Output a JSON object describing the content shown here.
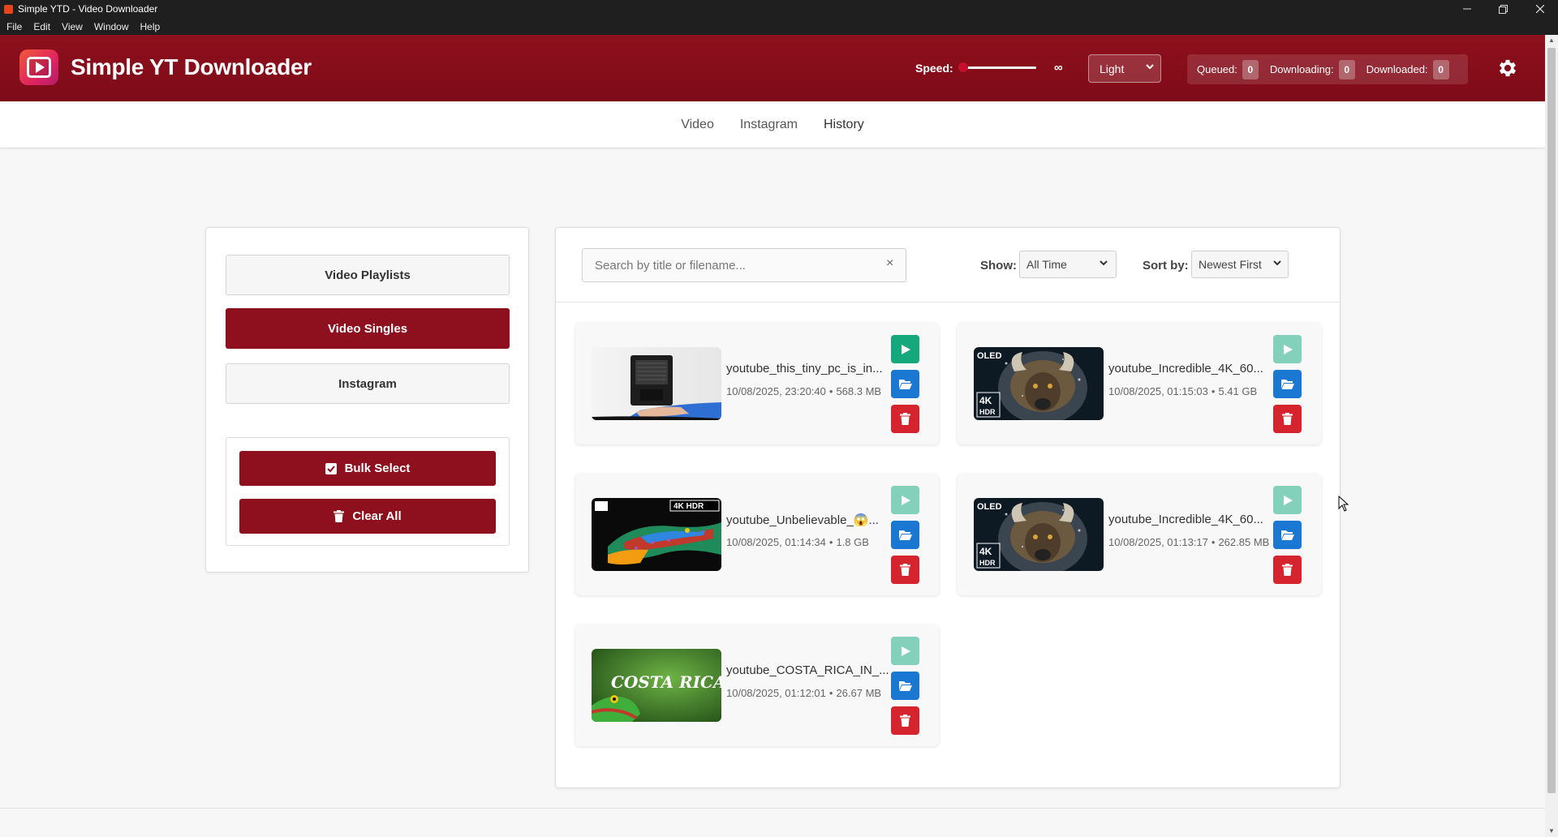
{
  "window": {
    "title": "Simple YTD - Video Downloader"
  },
  "menu": [
    "File",
    "Edit",
    "View",
    "Window",
    "Help"
  ],
  "header": {
    "brand": "Simple YT Downloader",
    "speed_label": "Speed:",
    "speed_value": "∞",
    "speed_level": 0,
    "theme": "Light",
    "counters": [
      {
        "label": "Queued:",
        "value": "0"
      },
      {
        "label": "Downloading:",
        "value": "0"
      },
      {
        "label": "Downloaded:",
        "value": "0"
      }
    ],
    "accent_color": "#8e0f1d"
  },
  "tabs": [
    "Video",
    "Instagram",
    "History"
  ],
  "active_tab": "History",
  "sidebar": {
    "items": [
      "Video Playlists",
      "Video Singles",
      "Instagram"
    ],
    "active": "Video Singles",
    "bulk_select": "Bulk Select",
    "clear_all": "Clear All"
  },
  "toolbar": {
    "search_placeholder": "Search by title or filename...",
    "search_clear": "×",
    "show_label": "Show:",
    "show_value": "All Time",
    "sort_label": "Sort by:",
    "sort_value": "Newest First"
  },
  "history": [
    {
      "title": "youtube_this_tiny_pc_is_in...",
      "date": "10/08/2025, 23:20:40",
      "size": "568.3 MB",
      "thumb": "tiny-pc",
      "play_enabled": true
    },
    {
      "title": "youtube_Incredible_4K_60...",
      "date": "10/08/2025, 01:15:03",
      "size": "5.41 GB",
      "thumb": "yak-oled",
      "play_enabled": false
    },
    {
      "title": "youtube_Unbelievable_😱...",
      "date": "10/08/2025, 01:14:34",
      "size": "1.8 GB",
      "thumb": "lizard-4k",
      "play_enabled": false
    },
    {
      "title": "youtube_Incredible_4K_60...",
      "date": "10/08/2025, 01:13:17",
      "size": "262.85 MB",
      "thumb": "yak-oled",
      "play_enabled": false
    },
    {
      "title": "youtube_COSTA_RICA_IN_...",
      "date": "10/08/2025, 01:12:01",
      "size": "26.67 MB",
      "thumb": "costa-rica",
      "play_enabled": false
    }
  ],
  "thumb_text": {
    "oled": "OLED",
    "k4": "4K",
    "hdr": "HDR",
    "k4hdr": "4K HDR",
    "costa": "COSTA RICA"
  }
}
